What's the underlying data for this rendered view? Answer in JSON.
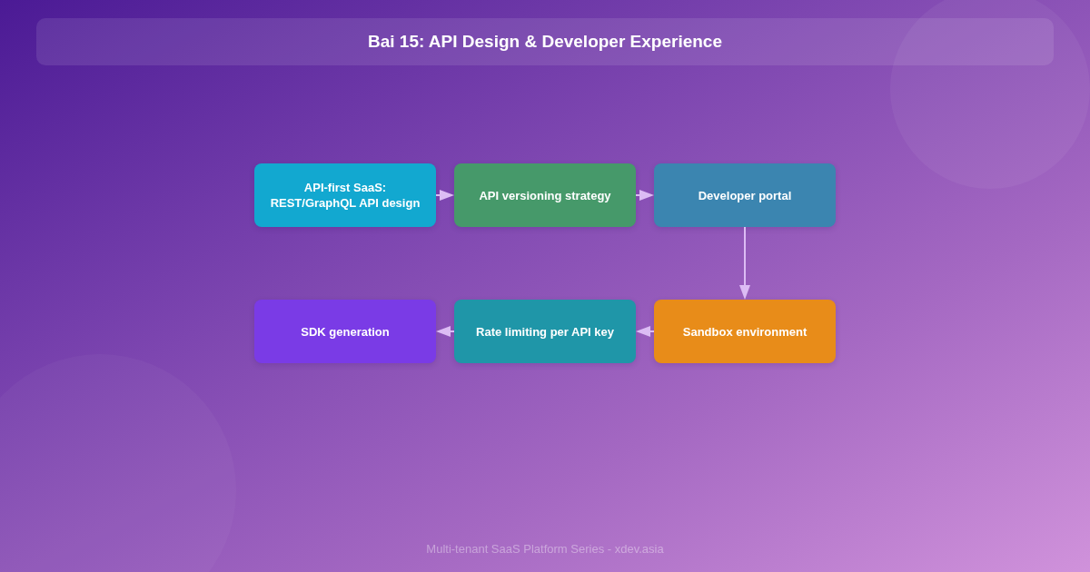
{
  "title": "Bai 15: API Design & Developer Experience",
  "diagram": {
    "rows": [
      {
        "reversed": false,
        "nodes": [
          {
            "label": "API-first SaaS: REST/GraphQL API design",
            "color": "#12a8d0"
          },
          {
            "label": "API versioning strategy",
            "color": "#46996a"
          },
          {
            "label": "Developer portal",
            "color": "#3b85b0"
          }
        ]
      },
      {
        "reversed": true,
        "nodes": [
          {
            "label": "SDK generation",
            "color": "#7a3be6"
          },
          {
            "label": "Rate limiting per API key",
            "color": "#1f96a8"
          },
          {
            "label": "Sandbox environment",
            "color": "#e88c19"
          }
        ]
      }
    ]
  },
  "footer": "Multi-tenant SaaS Platform Series - xdev.asia"
}
